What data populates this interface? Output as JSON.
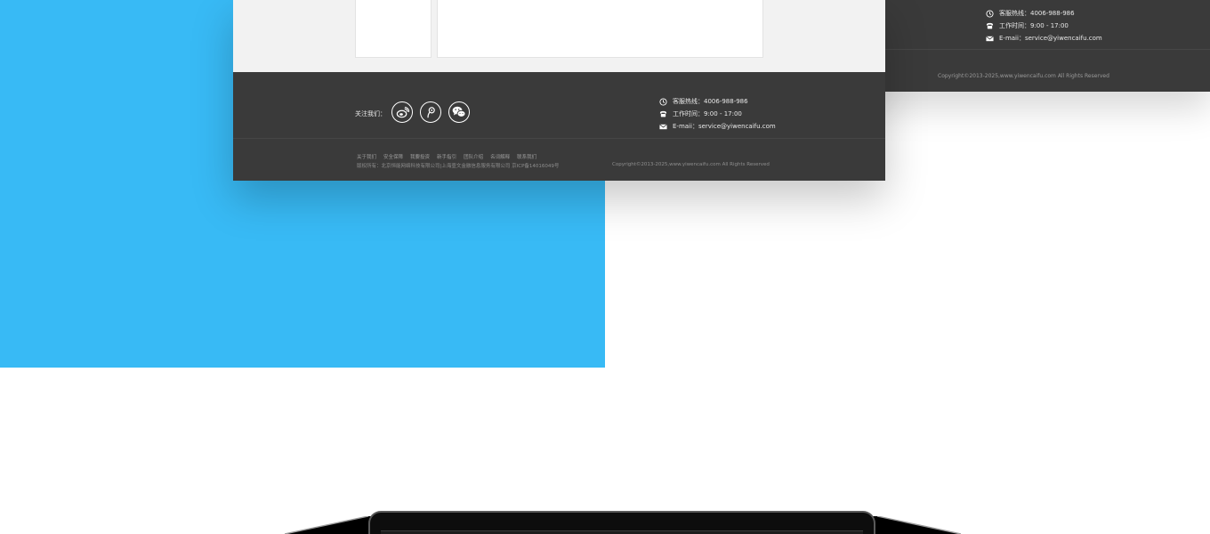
{
  "back_footer": {
    "hotline_label": "客服热线：",
    "hotline_value": "4006-988-986",
    "hours_label": "工作时间：",
    "hours_value": "9:00 - 17:00",
    "email_label": "E-maii：",
    "email_value": "service@yiwencaifu.com",
    "copyright": "Copyright©2013-2025,www.yiwencaifu.com All Rights Reserved"
  },
  "front_footer": {
    "follow_label": "关注我们：",
    "social": [
      {
        "icon": "weibo-icon"
      },
      {
        "icon": "tencent-weibo-icon"
      },
      {
        "icon": "wechat-icon"
      }
    ],
    "hotline_label": "客服热线：",
    "hotline_value": "4006-988-986",
    "hours_label": "工作时间：",
    "hours_value": "9:00 - 17:00",
    "email_label": "E-maii：",
    "email_value": "service@yiwencaifu.com",
    "links": [
      "关于我们",
      "安全保障",
      "我要投资",
      "新手指引",
      "团队介绍",
      "名词解释",
      "联系我们"
    ],
    "rights": "版权所有：北京恒能网络科技有限公司|上海壹文金融信息服务有限公司    京ICP备14016049号",
    "copyright": "Copyright©2013-2025,www.yiwencaifu.com All Rights Reserved"
  },
  "colors": {
    "blue_panel": "#38baf5",
    "footer_bg": "#3a3a3a",
    "content_bg": "#f2f2f2"
  }
}
